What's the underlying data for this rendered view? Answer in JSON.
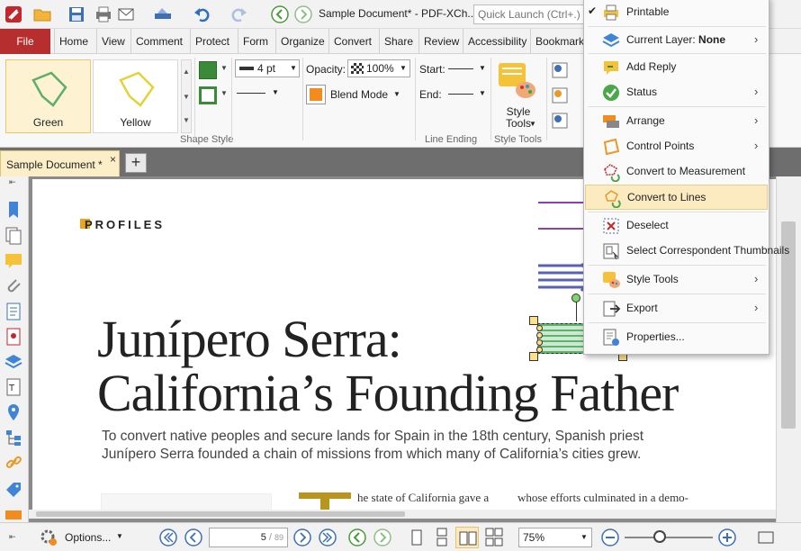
{
  "app": {
    "title": "Sample Document* - PDF-XCh...",
    "quick_launch_placeholder": "Quick Launch (Ctrl+.)"
  },
  "menu": {
    "file": "File",
    "tabs": [
      "Home",
      "View",
      "Comment",
      "Protect",
      "Form",
      "Organize",
      "Convert",
      "Share",
      "Review",
      "Accessibility",
      "Bookmark"
    ]
  },
  "ribbon": {
    "shapes": [
      {
        "label": "Green"
      },
      {
        "label": "Yellow"
      }
    ],
    "shape_style_label": "Shape Style",
    "line_width": "4 pt",
    "opacity_label": "Opacity:",
    "opacity_value": "100%",
    "blend_mode": "Blend Mode",
    "start_label": "Start:",
    "end_label": "End:",
    "line_ending_label": "Line Ending",
    "style_tools_label": "Style\nTools",
    "style_tools_group": "Style Tools",
    "colors": {
      "fill": "#3a8a3a",
      "stroke": "#3a8a3a",
      "blend": "#f28c1f"
    }
  },
  "document_tab": {
    "label": "Sample Document *",
    "close": "×",
    "new_tab": "+"
  },
  "page": {
    "section": "PROFILES",
    "headline_line1": "Junípero Serra:",
    "headline_line2": "California’s Founding Father",
    "subtitle": "To convert native peoples and secure lands for Spain in the 18th century, Spanish priest Junípero Serra founded a chain of missions from which many of California’s cities grew.",
    "body_col1": "he state of California gave a",
    "body_col2": "whose efforts culminated in a demo-",
    "accent_color": "#e6a61e"
  },
  "statusbar": {
    "options_label": "Options...",
    "page_current": "5",
    "page_total": "89",
    "zoom": "75%"
  },
  "context_menu": {
    "items": [
      {
        "label": "Printable",
        "icon": "printer-icon",
        "checked": true,
        "submenu": false
      },
      {
        "label": "Current Layer: None",
        "icon": "layers-icon",
        "submenu": true
      },
      {
        "label": "Add Reply",
        "icon": "reply-icon",
        "submenu": false
      },
      {
        "label": "Status",
        "icon": "status-check-icon",
        "submenu": true
      },
      {
        "label": "Arrange",
        "icon": "arrange-icon",
        "submenu": true
      },
      {
        "label": "Control Points",
        "icon": "control-points-icon",
        "submenu": true
      },
      {
        "label": "Convert to Measurement",
        "icon": "measurement-icon",
        "submenu": false
      },
      {
        "label": "Convert to Lines",
        "icon": "convert-lines-icon",
        "submenu": false,
        "highlighted": true
      },
      {
        "label": "Deselect",
        "icon": "deselect-icon",
        "submenu": false
      },
      {
        "label": "Select Correspondent Thumbnails",
        "icon": "thumbnails-icon",
        "submenu": false
      },
      {
        "label": "Style Tools",
        "icon": "style-tools-icon",
        "submenu": true
      },
      {
        "label": "Export",
        "icon": "export-icon",
        "submenu": true
      },
      {
        "label": "Properties...",
        "icon": "properties-icon",
        "submenu": false
      }
    ]
  }
}
